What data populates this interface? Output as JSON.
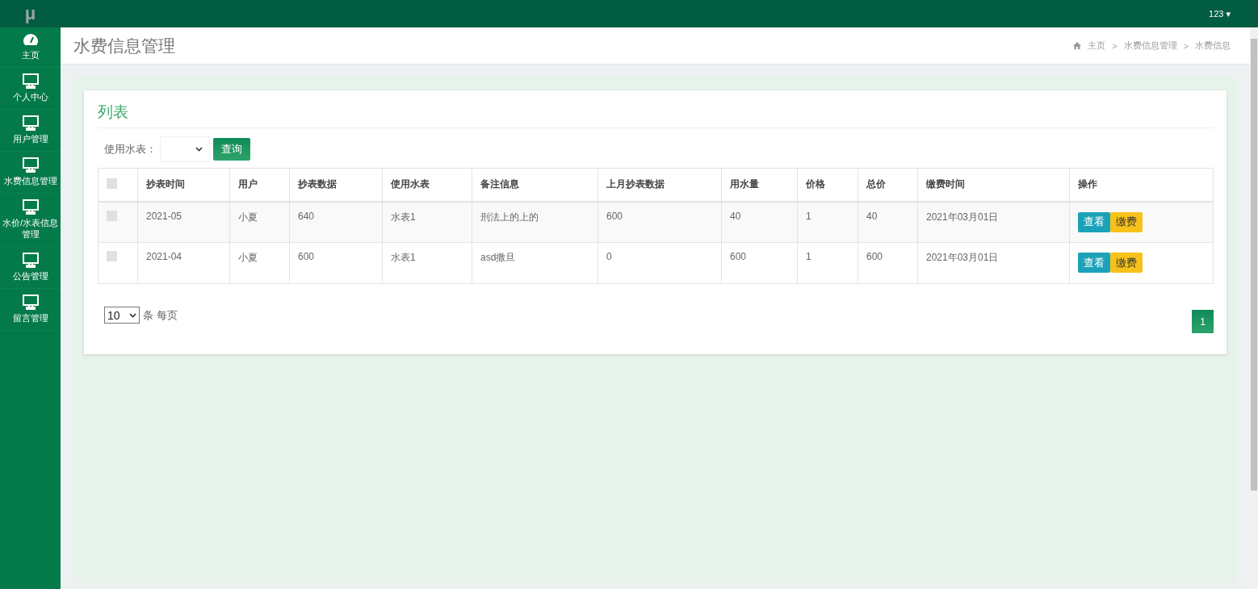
{
  "topbar": {
    "logo": "μ",
    "user": "123",
    "user_caret": "▾"
  },
  "sidebar": {
    "items": [
      {
        "label": "主页"
      },
      {
        "label": "个人中心"
      },
      {
        "label": "用户管理"
      },
      {
        "label": "水费信息管理"
      },
      {
        "label": "水价/水表信息管理"
      },
      {
        "label": "公告管理"
      },
      {
        "label": "留言管理"
      }
    ]
  },
  "header": {
    "title": "水费信息管理",
    "breadcrumb": [
      "主页",
      "水费信息管理",
      "水费信息"
    ],
    "separator": ">"
  },
  "card": {
    "title": "列表",
    "filter": {
      "label": "使用水表：",
      "button": "查询"
    },
    "table": {
      "header_checked": false,
      "columns": [
        "抄表时间",
        "用户",
        "抄表数据",
        "使用水表",
        "备注信息",
        "上月抄表数据",
        "用水量",
        "价格",
        "总价",
        "缴费时间",
        "操作"
      ],
      "rows": [
        {
          "checked": false,
          "cells": [
            "2021-05",
            "小夏",
            "640",
            "水表1",
            "刑法上的上的",
            "600",
            "40",
            "1",
            "40",
            "2021年03月01日"
          ],
          "actions": [
            "查看",
            "缴费"
          ]
        },
        {
          "checked": false,
          "cells": [
            "2021-04",
            "小夏",
            "600",
            "水表1",
            "asd撒旦",
            "0",
            "600",
            "1",
            "600",
            "2021年03月01日"
          ],
          "actions": [
            "查看",
            "缴费"
          ]
        }
      ]
    },
    "page_size": {
      "value": "10",
      "label": "条 每页"
    },
    "pages": [
      {
        "label": "1",
        "selected": true
      }
    ]
  }
}
